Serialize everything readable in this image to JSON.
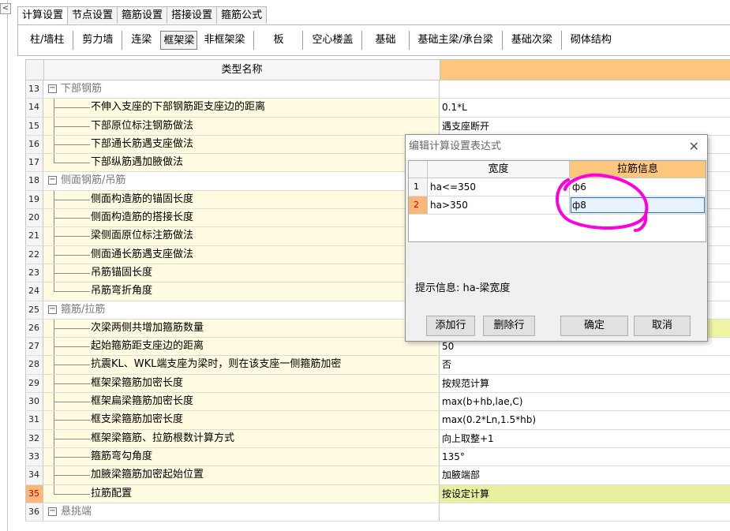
{
  "tabs": [
    "计算设置",
    "节点设置",
    "箍筋设置",
    "搭接设置",
    "箍筋公式"
  ],
  "subtabs": [
    "柱/墙柱",
    "剪力墙",
    "连梁",
    "框架梁",
    "非框架梁",
    "板",
    "空心楼盖",
    "基础",
    "基础主梁/承台梁",
    "基础次梁",
    "砌体结构"
  ],
  "grid": {
    "header_name": "类型名称",
    "rows": [
      {
        "num": "13",
        "name": "下部钢筋",
        "value": ""
      },
      {
        "num": "14",
        "name": "不伸入支座的下部钢筋距支座边的距离",
        "value": "0.1*L"
      },
      {
        "num": "15",
        "name": "下部原位标注钢筋做法",
        "value": "遇支座断开"
      },
      {
        "num": "16",
        "name": "下部通长筋遇支座做法",
        "value": ""
      },
      {
        "num": "17",
        "name": "下部纵筋遇加腋做法",
        "value": ""
      },
      {
        "num": "18",
        "name": "侧面钢筋/吊筋",
        "value": ""
      },
      {
        "num": "19",
        "name": "侧面构造筋的锚固长度",
        "value": ""
      },
      {
        "num": "20",
        "name": "侧面构造筋的搭接长度",
        "value": ""
      },
      {
        "num": "21",
        "name": "梁侧面原位标注筋做法",
        "value": ""
      },
      {
        "num": "22",
        "name": "侧面通长筋遇支座做法",
        "value": ""
      },
      {
        "num": "23",
        "name": "吊筋锚固长度",
        "value": ""
      },
      {
        "num": "24",
        "name": "吊筋弯折角度",
        "value": ""
      },
      {
        "num": "25",
        "name": "箍筋/拉筋",
        "value": ""
      },
      {
        "num": "26",
        "name": "次梁两侧共增加箍筋数量",
        "value": ""
      },
      {
        "num": "27",
        "name": "起始箍筋距支座边的距离",
        "value": "50"
      },
      {
        "num": "28",
        "name": "抗震KL、WKL端支座为梁时，则在该支座一侧箍筋加密",
        "value": "否"
      },
      {
        "num": "29",
        "name": "框架梁箍筋加密长度",
        "value": "按规范计算"
      },
      {
        "num": "30",
        "name": "框架扁梁箍筋加密长度",
        "value": "max(b+hb,lae,C)"
      },
      {
        "num": "31",
        "name": "框支梁箍筋加密长度",
        "value": "max(0.2*Ln,1.5*hb)"
      },
      {
        "num": "32",
        "name": "框架梁箍筋、拉筋根数计算方式",
        "value": "向上取整+1"
      },
      {
        "num": "33",
        "name": "箍筋弯勾角度",
        "value": "135°"
      },
      {
        "num": "34",
        "name": "加腋梁箍筋加密起始位置",
        "value": "加腋端部"
      },
      {
        "num": "35",
        "name": "拉筋配置",
        "value": "按设定计算"
      },
      {
        "num": "36",
        "name": "悬挑端",
        "value": ""
      }
    ]
  },
  "dialog": {
    "title": "编辑计算设置表达式",
    "col_width": "宽度",
    "col_tie": "拉筋信息",
    "rows": [
      {
        "num": "1",
        "width": "ha<=350",
        "tie": "ф6"
      },
      {
        "num": "2",
        "width": "ha>350",
        "tie": "ф8"
      }
    ],
    "hint": "提示信息: ha-梁宽度",
    "add_row": "添加行",
    "delete_row": "删除行",
    "ok": "确定",
    "cancel": "取消"
  },
  "colors": {
    "header_orange": "#fcc77c",
    "selected_row": "#f9b77a",
    "highlight": "#e8f0a0",
    "annotation": "#ff00dd"
  }
}
